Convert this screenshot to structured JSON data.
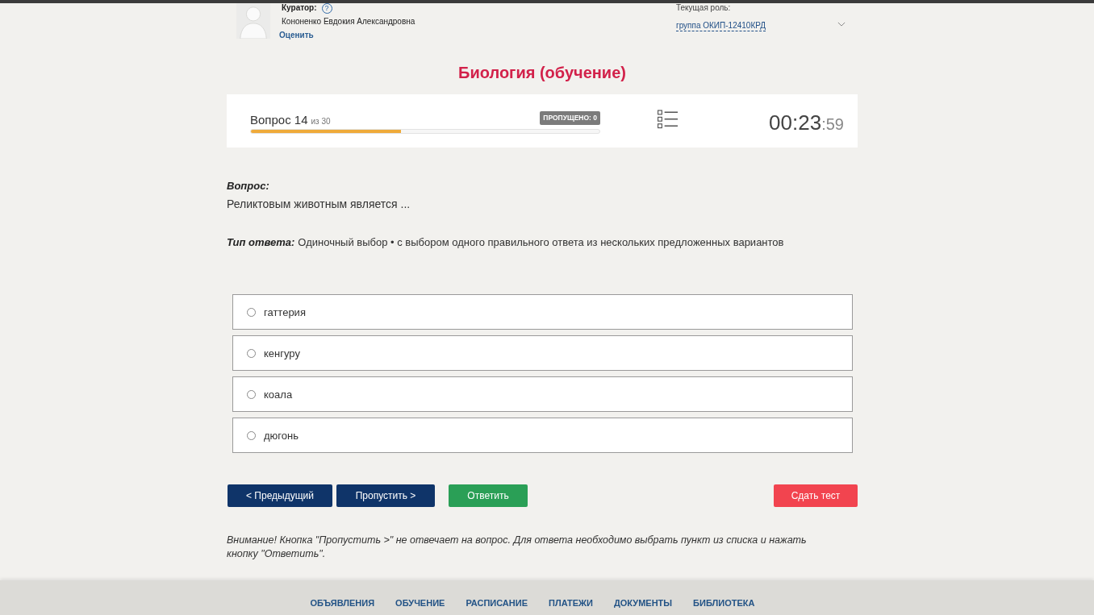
{
  "header": {
    "curator": {
      "label": "Куратор:",
      "help_icon": "?",
      "name": "Кононенко Евдокия Александровна",
      "rate_link": "Оценить"
    },
    "role": {
      "label": "Текущая роль:",
      "value": "группа ОКИП-12410КРД"
    }
  },
  "title": "Биология (обучение)",
  "progress": {
    "question_label": "Вопрос 14",
    "total": "из 30",
    "skipped_badge": "ПРОПУЩЕНО: 0",
    "level": 0.43,
    "timer": {
      "main": "00:23",
      "seconds": ":59"
    }
  },
  "question": {
    "label": "Вопрос:",
    "text": "Реликтовым животным является ...",
    "answer_type_label": "Тип ответа:",
    "answer_type": "Одиночный выбор • с выбором одного правильного ответа из нескольких предложенных вариантов"
  },
  "options": [
    {
      "label": "гаттерия",
      "selected": false
    },
    {
      "label": "кенгуру",
      "selected": false
    },
    {
      "label": "коала",
      "selected": false
    },
    {
      "label": "дюгонь",
      "selected": false
    }
  ],
  "buttons": [
    {
      "label": "< Предыдущий",
      "kind": "primary"
    },
    {
      "label": "Пропустить >",
      "kind": "primary"
    },
    {
      "label": "Ответить",
      "kind": "success"
    },
    {
      "label": "Сдать тест",
      "kind": "danger"
    }
  ],
  "notice": "Внимание! Кнопка \"Пропустить >\" не отвечает на вопрос. Для ответа необходимо выбрать пункт из списка и нажать кнопку \"Ответить\".",
  "footer_nav": [
    "ОБЪЯВЛЕНИЯ",
    "ОБУЧЕНИЕ",
    "РАСПИСАНИЕ",
    "ПЛАТЕЖИ",
    "ДОКУМЕНТЫ",
    "БИБЛИОТЕКА"
  ]
}
